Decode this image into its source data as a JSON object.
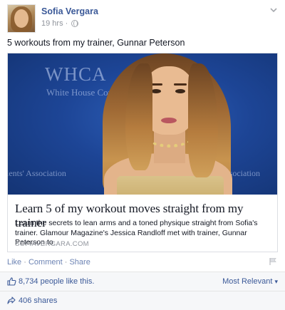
{
  "post": {
    "author": "Sofia Vergara",
    "time": "19 hrs",
    "separator": "·",
    "status_text": "5 workouts from my trainer, Gunnar Peterson"
  },
  "attachment": {
    "image_watermarks": {
      "title": "WHCA",
      "subtitle": "White House Corresp",
      "subtitle_end": "n",
      "left_text": "lents' Association",
      "right_text": "ssociation"
    },
    "title": "Learn 5 of my workout moves straight from my trainer",
    "description": "Learn the secrets to lean arms and a toned physique straight from Sofia's trainer. Glamour Magazine's Jessica Randloff met with trainer, Gunnar Peterson to",
    "domain": "SOFIAVERGARA.COM"
  },
  "actions": {
    "like": "Like",
    "comment": "Comment",
    "share": "Share",
    "dot": "·"
  },
  "engagement": {
    "likes_text": "8,734 people like this.",
    "sort_label": "Most Relevant",
    "sort_caret": "▾",
    "shares_text": "406 shares"
  },
  "icons": {
    "chevron": "chevron-down-icon",
    "globe": "globe-icon",
    "thumb": "thumbs-up-icon",
    "share": "share-icon",
    "flag": "flag-icon"
  },
  "colors": {
    "link_blue": "#3b5998",
    "muted": "#90949c",
    "action_blue": "#6d84b4",
    "footer_bg": "#f6f7f9"
  }
}
